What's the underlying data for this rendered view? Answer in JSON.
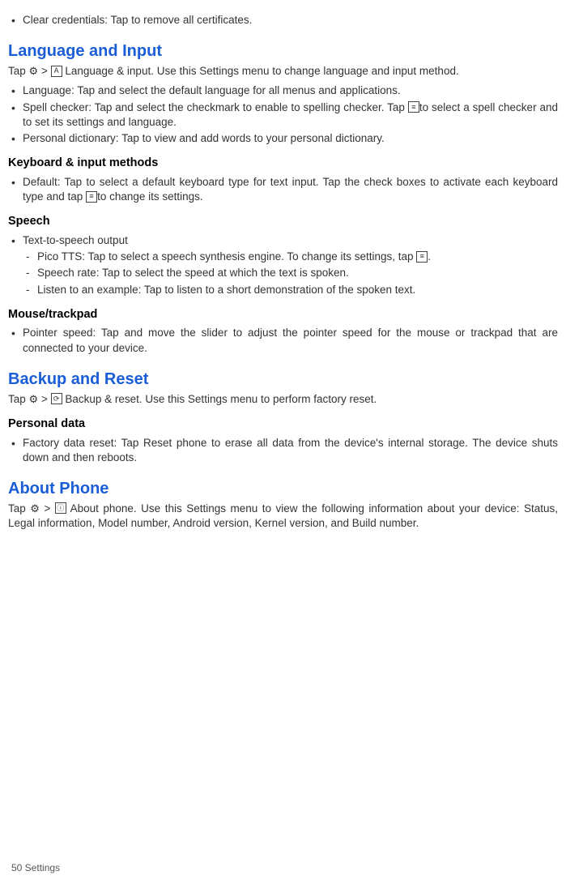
{
  "top_bullet": "Clear credentials: Tap to remove all  certificates.",
  "lang_input": {
    "heading": "Language and Input",
    "intro_a": "Tap ",
    "intro_b": "> ",
    "intro_c": "Language & input. Use this Settings menu to change language and input method.",
    "bullets": {
      "language": "Language: Tap and select the default language for all menus and  applications.",
      "spell_a": "Spell checker: Tap and select the checkmark to enable to spelling checker. Tap ",
      "spell_b": "to select a spell checker and to set its settings and  language.",
      "personal_dict": "Personal dictionary: Tap to view and add words to your personal dictionary."
    },
    "keyboard_heading": "Keyboard & input methods",
    "keyboard_a": "Default: Tap to select a default keyboard type for text input. Tap the check boxes to activate each keyboard type and tap ",
    "keyboard_b": "to change its  settings.",
    "speech_heading": "Speech",
    "speech_parent": "Text-to-speech output",
    "speech_pico_a": "Pico TTS: Tap to select a speech synthesis engine. To change its settings, tap ",
    "speech_pico_b": ".",
    "speech_rate": "Speech rate: Tap to select the speed at which the text is   spoken.",
    "speech_listen": "Listen to an example: Tap to listen to a short demonstration of the spoken text.",
    "mouse_heading": "Mouse/trackpad",
    "mouse_bullet": "Pointer speed: Tap and move the slider to adjust the pointer speed for the mouse or trackpad that are connected to your  device."
  },
  "backup": {
    "heading": "Backup and Reset",
    "intro_a": "Tap ",
    "intro_b": "> ",
    "intro_c": "Backup & reset. Use this Settings menu to perform factory   reset.",
    "personal_heading": "Personal data",
    "factory_reset": "Factory data reset: Tap Reset phone to erase all data from the device's internal storage. The device shuts down and then  reboots."
  },
  "about": {
    "heading": "About Phone",
    "intro_a": "Tap ",
    "intro_b": "> ",
    "intro_c": "About phone. Use this Settings menu to view the following information about your device: Status, Legal information, Model number, Android version, Kernel version, and Build number."
  },
  "footer": "50  Settings",
  "icons": {
    "gear": "⚙",
    "letter_a": "A",
    "sliders": "≡",
    "reset": "⟳",
    "info": "ⓘ"
  }
}
